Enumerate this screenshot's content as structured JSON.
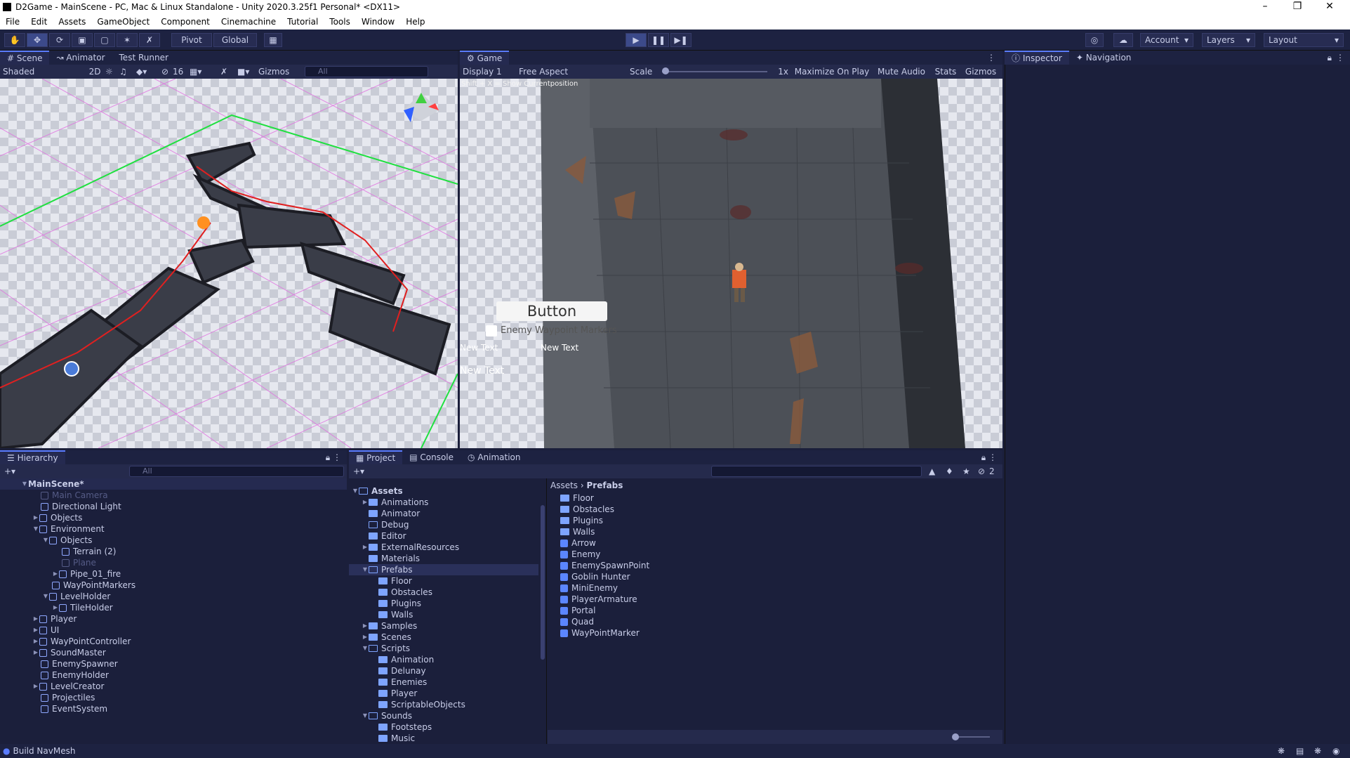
{
  "window": {
    "title": "D2Game - MainScene - PC, Mac & Linux Standalone - Unity 2020.3.25f1 Personal* <DX11>"
  },
  "menu": [
    "File",
    "Edit",
    "Assets",
    "GameObject",
    "Component",
    "Cinemachine",
    "Tutorial",
    "Tools",
    "Window",
    "Help"
  ],
  "toolbar": {
    "pivot": "Pivot",
    "global": "Global",
    "account": "Account",
    "layers": "Layers",
    "layout": "Layout"
  },
  "scene_panel": {
    "tabs": [
      "Scene",
      "Animator",
      "Test Runner"
    ],
    "shading": "Shaded",
    "mode2d": "2D",
    "hidden_count": "16",
    "gizmos": "Gizmos",
    "search_placeholder": "All"
  },
  "game_panel": {
    "tab": "Game",
    "display": "Display 1",
    "aspect": "Free Aspect",
    "scale_label": "Scale",
    "scale_value": "1x",
    "maximize": "Maximize On Play",
    "mute": "Mute Audio",
    "stats": "Stats",
    "gizmos": "Gizmos",
    "overlay_hint": "Shift + X = Show Currentposition",
    "ui_button": "Button",
    "ui_toggle": "Enemy Waypoint Markers",
    "new_text_1": "New Text",
    "new_text_2": "New Text",
    "new_text_3": "New Text"
  },
  "inspector": {
    "tabs": [
      "Inspector",
      "Navigation"
    ]
  },
  "hierarchy": {
    "tab": "Hierarchy",
    "search_placeholder": "All",
    "scene": "MainScene*",
    "items": [
      "Main Camera",
      "Directional Light",
      "Objects",
      "Environment",
      "Objects",
      "Terrain (2)",
      "Plane",
      "Pipe_01_fire",
      "WayPointMarkers",
      "LevelHolder",
      "TileHolder",
      "Player",
      "UI",
      "WayPointController",
      "SoundMaster",
      "EnemySpawner",
      "EnemyHolder",
      "LevelCreator",
      "Projectiles",
      "EventSystem"
    ]
  },
  "project": {
    "tabs": [
      "Project",
      "Console",
      "Animation"
    ],
    "hidden_count": "2",
    "tree": [
      "Assets",
      "Animations",
      "Animator",
      "Debug",
      "Editor",
      "ExternalResources",
      "Materials",
      "Prefabs",
      "Floor",
      "Obstacles",
      "Plugins",
      "Walls",
      "Samples",
      "Scenes",
      "Scripts",
      "Animation",
      "Delunay",
      "Enemies",
      "Player",
      "ScriptableObjects",
      "Sounds",
      "Footsteps",
      "Music"
    ],
    "breadcrumb": [
      "Assets",
      "Prefabs"
    ],
    "folders": [
      "Floor",
      "Obstacles",
      "Plugins",
      "Walls"
    ],
    "prefabs": [
      "Arrow",
      "Enemy",
      "EnemySpawnPoint",
      "Goblin Hunter",
      "MiniEnemy",
      "PlayerArmature",
      "Portal",
      "Quad",
      "WayPointMarker"
    ]
  },
  "status": {
    "text": "Build NavMesh"
  },
  "colors": {
    "accent": "#5a7cff",
    "panel": "#1b1f3b",
    "toolbar": "#1d2241",
    "play_active": "#3c4a8a"
  }
}
